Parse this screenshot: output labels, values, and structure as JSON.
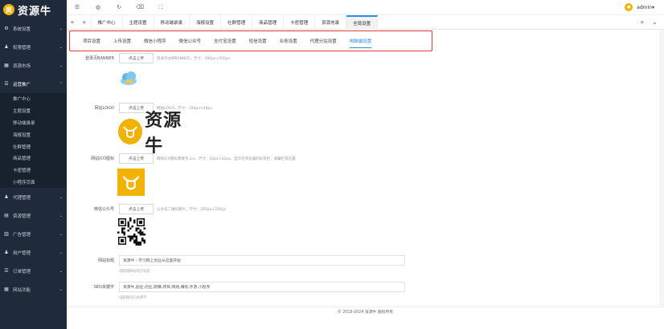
{
  "app": {
    "logo_text": "资源牛",
    "logo_badge": "资"
  },
  "sidebar": {
    "items": [
      {
        "label": "系统设置",
        "icon": "gear-icon",
        "glyph": "⚙"
      },
      {
        "label": "权限管理",
        "icon": "user-shield-icon",
        "glyph": "♟"
      },
      {
        "label": "资源市场",
        "icon": "grid-icon",
        "glyph": "▦"
      },
      {
        "label": "运营推广",
        "icon": "list-icon",
        "glyph": "☰"
      }
    ],
    "sub_items": [
      "推广中心",
      "主题设置",
      "移动端录录",
      "海报设置",
      "社群管理",
      "商品管理",
      "卡密管理",
      "小程序页面"
    ],
    "bottom_items": [
      {
        "label": "代理管理",
        "icon": "people-icon",
        "glyph": "♟"
      },
      {
        "label": "资源管理",
        "icon": "folder-icon",
        "glyph": "▤"
      },
      {
        "label": "广告管理",
        "icon": "ad-icon",
        "glyph": "▥"
      },
      {
        "label": "用户管理",
        "icon": "user-icon",
        "glyph": "♟"
      },
      {
        "label": "订单管理",
        "icon": "order-icon",
        "glyph": "☰"
      },
      {
        "label": "网站功能",
        "icon": "apps-icon",
        "glyph": "▦"
      }
    ]
  },
  "topbar": {
    "user": "admin",
    "user_chev": "▾"
  },
  "tabs": {
    "items": [
      "推广中心",
      "主题设置",
      "移动端录录",
      "海报设置",
      "社群管理",
      "商品管理",
      "卡密管理",
      "资源充录",
      "全局设置"
    ],
    "active_index": 8
  },
  "settings_tabs": {
    "items": [
      "项目设置",
      "上传设置",
      "微信小程序",
      "微信公众号",
      "支付宝设置",
      "短信设置",
      "业务设置",
      "代理分站设置",
      "电脑端设置"
    ],
    "active_index": 8
  },
  "form": {
    "upload_label": "点击上传",
    "banner": {
      "label": "登录页BANNER",
      "hint": "登录页左侧BANNER，尺寸：380px×450px"
    },
    "logo": {
      "label": "网站LOGO",
      "hint": "网站LOGO，尺寸：180px×48px",
      "image_text": "资源牛"
    },
    "ico": {
      "label": "网站ICO图标",
      "hint": "网站ICO图标需要为.ico，尺寸：32px×32px，显示在浏览器的标签栏、收藏栏等位置"
    },
    "wechat": {
      "label": "微信公众号",
      "hint": "公众号二维码图片，尺寸：320px×320px"
    },
    "site_title": {
      "label": "网站标题",
      "value": "资源牛 - 学习网上创业从这里开始",
      "subhint": "电脑端网站网页标题"
    },
    "seo_keywords": {
      "label": "SEO关键字",
      "value": "资源牛,副业,创业,网赚,项目,网络,赚钱,手游,小程序",
      "subhint": "电脑端SEO关键字"
    }
  },
  "footer": {
    "text": "© 2019-2024 资源牛 版权所有"
  },
  "colors": {
    "sidebar_bg": "#1f2a3a",
    "accent": "#2d8cf0",
    "brand": "#f2b300",
    "highlight": "#e33d3d"
  }
}
